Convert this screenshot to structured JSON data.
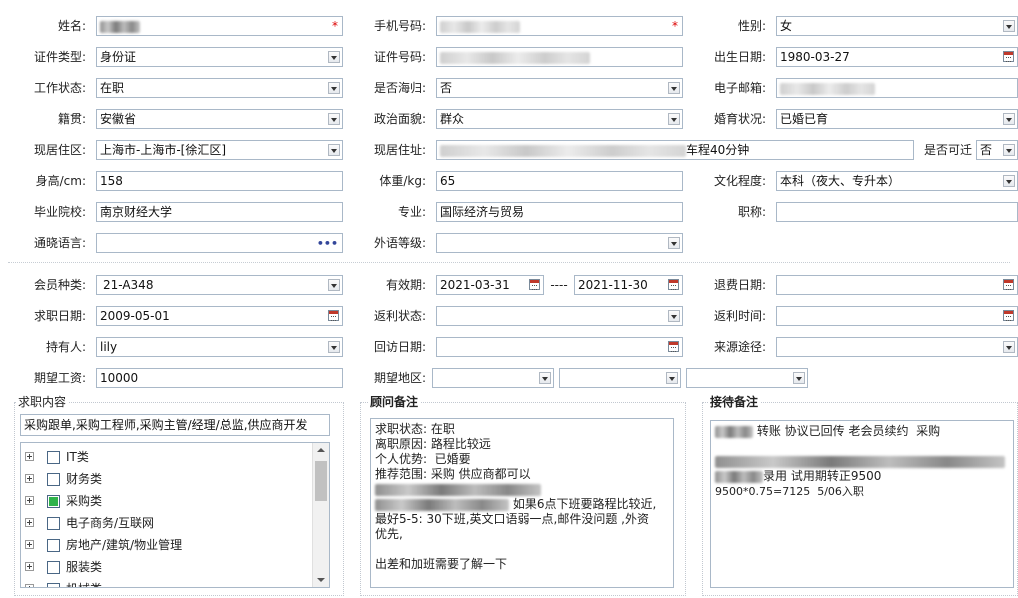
{
  "personal": {
    "name_label": "姓名:",
    "phone_label": "手机号码:",
    "gender_label": "性别:",
    "gender_value": "女",
    "id_type_label": "证件类型:",
    "id_type_value": "身份证",
    "id_number_label": "证件号码:",
    "birth_label": "出生日期:",
    "birth_value": "1980-03-27",
    "work_status_label": "工作状态:",
    "work_status_value": "在职",
    "returnee_label": "是否海归:",
    "returnee_value": "否",
    "email_label": "电子邮箱:",
    "native_label": "籍贯:",
    "native_value": "安徽省",
    "political_label": "政治面貌:",
    "political_value": "群众",
    "marital_label": "婚育状况:",
    "marital_value": "已婚已育",
    "district_label": "现居住区:",
    "district_value": "上海市-上海市-[徐汇区]",
    "address_label": "现居住址:",
    "address_suffix": "车程40分钟",
    "relocate_label": "是否可迁",
    "relocate_value": "否",
    "height_label": "身高/cm:",
    "height_value": "158",
    "weight_label": "体重/kg:",
    "weight_value": "65",
    "education_label": "文化程度:",
    "education_value": "本科（夜大、专升本）",
    "school_label": "毕业院校:",
    "school_value": "南京财经大学",
    "major_label": "专业:",
    "major_value": "国际经济与贸易",
    "title_label": "职称:",
    "language_label": "通晓语言:",
    "language_dots": "•••",
    "foreign_level_label": "外语等级:",
    "required_mark": "*"
  },
  "membership": {
    "type_label": "会员种类:",
    "type_value": "21-A348",
    "valid_label": "有效期:",
    "valid_from": "2021-03-31",
    "valid_sep": "----",
    "valid_to": "2021-11-30",
    "refund_date_label": "退费日期:",
    "job_date_label": "求职日期:",
    "job_date_value": "2009-05-01",
    "rebate_status_label": "返利状态:",
    "rebate_time_label": "返利时间:",
    "holder_label": "持有人:",
    "holder_value": "lily",
    "visit_date_label": "回访日期:",
    "source_label": "来源途径:",
    "salary_label": "期望工资:",
    "salary_value": "10000",
    "region_label": "期望地区:"
  },
  "job_content": {
    "title": "求职内容",
    "summary": "采购跟单,采购工程师,采购主管/经理/总监,供应商开发",
    "tree": [
      {
        "label": "IT类",
        "checked": false
      },
      {
        "label": "财务类",
        "checked": false
      },
      {
        "label": "采购类",
        "checked": true
      },
      {
        "label": "电子商务/互联网",
        "checked": false
      },
      {
        "label": "房地产/建筑/物业管理",
        "checked": false
      },
      {
        "label": "服装类",
        "checked": false
      },
      {
        "label": "机械类",
        "checked": false
      }
    ]
  },
  "advisor_notes": {
    "title": "顾问备注",
    "line1": "求职状态: 在职",
    "line2": "离职原因: 路程比较远",
    "line3": "个人优势:  已婚要",
    "line4": "推荐范围: 采购 供应商都可以",
    "line6_suffix": " 如果6点下班要路程比较近,",
    "line7": "最好5-5: 30下班,英文口语弱一点,邮件没问题 ,外资",
    "line8": "优先,",
    "line10": "出差和加班需要了解一下"
  },
  "reception_notes": {
    "title": "接待备注",
    "line1_suffix": " 转账 协议已回传 老会员续约  采购",
    "line3_suffix": "录用 试用期转正9500",
    "line4": "9500*0.75=7125  5/06入职"
  }
}
